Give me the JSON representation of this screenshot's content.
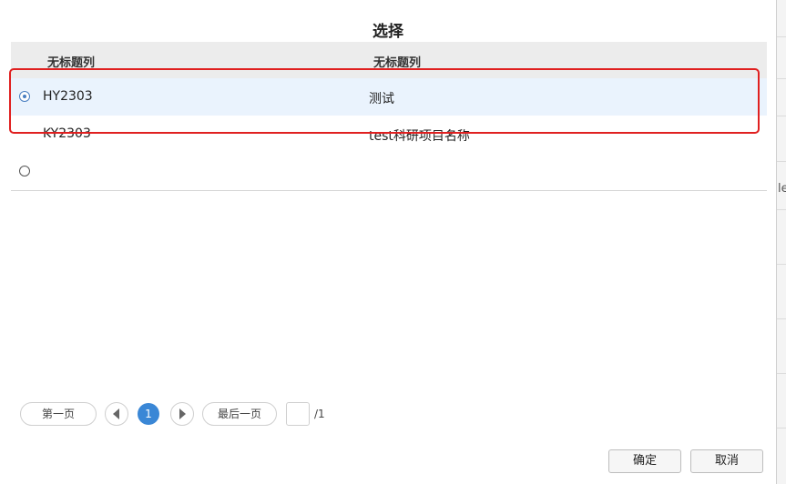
{
  "dialog": {
    "title": "选择"
  },
  "table": {
    "columns": [
      "无标题列",
      "无标题列"
    ],
    "rows": [
      {
        "code": "HY2303",
        "name": "测试",
        "selected": true
      },
      {
        "code": "KY2303",
        "name": "test科研项目名称",
        "selected": false
      },
      {
        "code": "",
        "name": "",
        "selected": false
      }
    ]
  },
  "pager": {
    "first_label": "第一页",
    "last_label": "最后一页",
    "current_page": "1",
    "page_input_value": "",
    "total_pages": "/1"
  },
  "footer": {
    "ok_label": "确定",
    "cancel_label": "取消"
  },
  "background": {
    "fragment": "le"
  },
  "colors": {
    "selected_row_bg": "#eaf3fd",
    "highlight_box": "#e02020",
    "current_page_bg": "#3a87d6"
  }
}
